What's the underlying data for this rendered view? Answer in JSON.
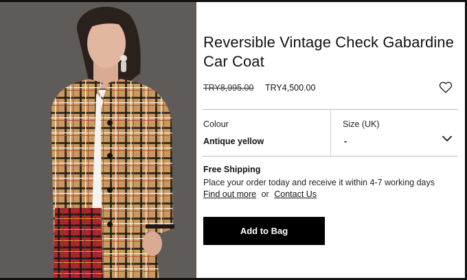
{
  "product": {
    "title_line1": "Reversible Vintage Check Gabardine",
    "title_line2": "Car Coat",
    "price_original": "TRY8,995.00",
    "price_sale": "TRY4,500.00",
    "image_alt": "Model wearing a vintage check car coat",
    "wishlist_icon": "heart-outline-icon"
  },
  "options": {
    "colour_label": "Colour",
    "colour_value": "Antique yellow",
    "size_label": "Size (UK)",
    "size_value": "-",
    "size_icon": "chevron-down-icon"
  },
  "shipping": {
    "title": "Free Shipping",
    "text": "Place your order today and receive it within 4-7 working days",
    "link_find_out": "Find out more",
    "connector": "or",
    "link_contact": "Contact Us"
  },
  "actions": {
    "add_to_bag": "Add to Bag"
  },
  "colors": {
    "button_bg": "#000000",
    "button_text": "#ffffff",
    "divider": "#bdbdbd",
    "photo_background": "#5f5b58"
  }
}
